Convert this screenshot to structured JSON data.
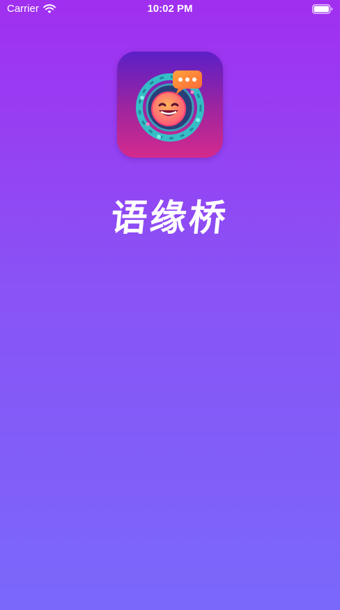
{
  "status_bar": {
    "carrier": "Carrier",
    "time": "10:02 PM",
    "wifi_icon": "wifi-icon",
    "battery_icon": "battery-icon"
  },
  "app": {
    "name": "语缘桥",
    "logo_icon": "chat-face-logo-icon"
  },
  "colors": {
    "background_top": "#a12ff0",
    "background_bottom": "#7a68fb",
    "logo_top": "#5b1fc7",
    "logo_bottom": "#d42a8c",
    "accent_orange": "#ff8a3d"
  }
}
